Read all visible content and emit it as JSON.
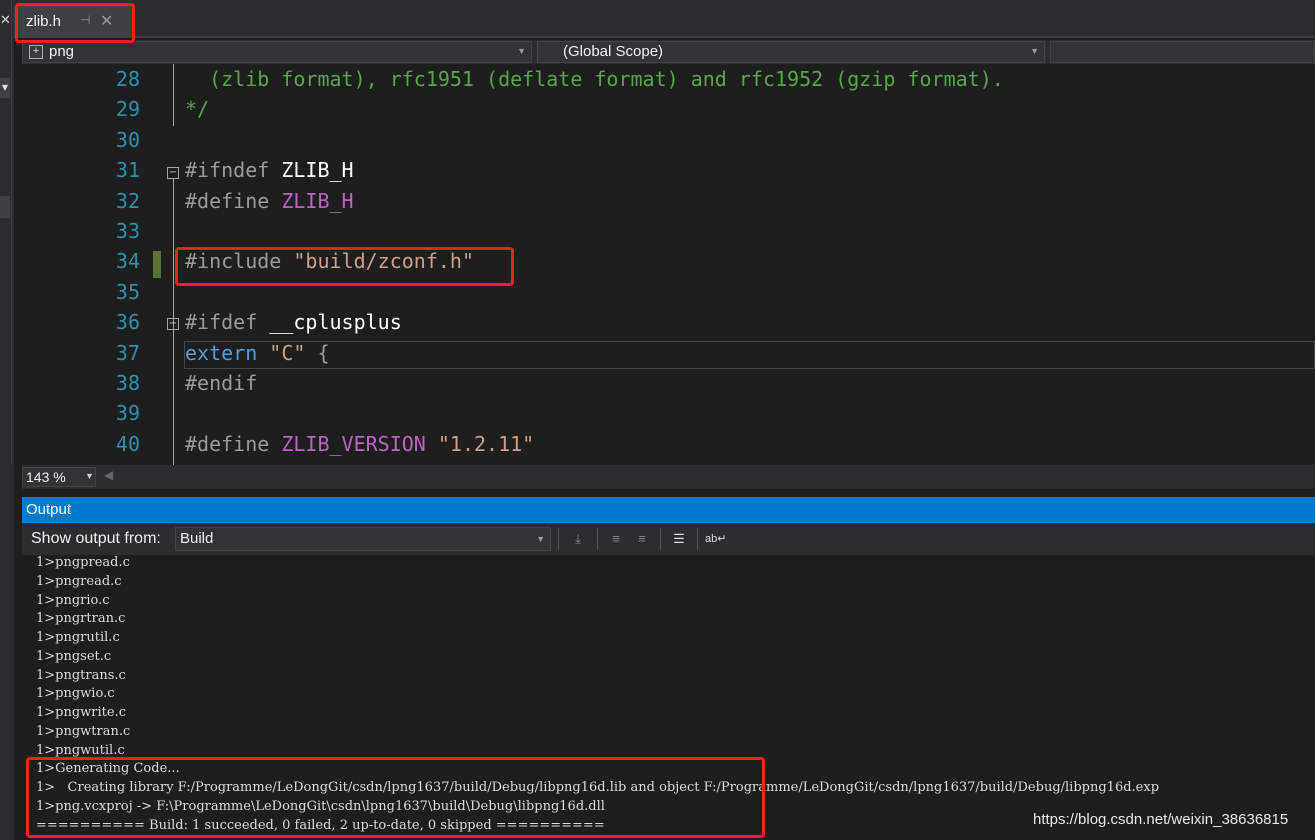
{
  "tab": {
    "title": "zlib.h",
    "pin_glyph": "⊣",
    "close_glyph": "✕"
  },
  "nav": {
    "project": "png",
    "scope": "(Global Scope)",
    "member": ""
  },
  "editor": {
    "lines": [
      {
        "num": "28",
        "segments": [
          {
            "t": "  (zlib format), rfc1951 (deflate format) and rfc1952 (gzip format).",
            "c": "cm"
          }
        ]
      },
      {
        "num": "29",
        "segments": [
          {
            "t": "*/",
            "c": "cm"
          }
        ]
      },
      {
        "num": "30",
        "segments": []
      },
      {
        "num": "31",
        "segments": [
          {
            "t": "#ifndef ",
            "c": "pp"
          },
          {
            "t": "ZLIB_H",
            "c": "id"
          }
        ]
      },
      {
        "num": "32",
        "segments": [
          {
            "t": "#define ",
            "c": "pp"
          },
          {
            "t": "ZLIB_H",
            "c": "mac"
          }
        ]
      },
      {
        "num": "33",
        "segments": []
      },
      {
        "num": "34",
        "segments": [
          {
            "t": "#include ",
            "c": "pp"
          },
          {
            "t": "\"build/zconf.h\"",
            "c": "str"
          }
        ]
      },
      {
        "num": "35",
        "segments": []
      },
      {
        "num": "36",
        "segments": [
          {
            "t": "#ifdef ",
            "c": "pp"
          },
          {
            "t": "__cplusplus",
            "c": "id"
          }
        ]
      },
      {
        "num": "37",
        "segments": [
          {
            "t": "extern ",
            "c": "kw"
          },
          {
            "t": "\"C\" ",
            "c": "str"
          },
          {
            "t": "{",
            "c": "pp"
          }
        ]
      },
      {
        "num": "38",
        "segments": [
          {
            "t": "#endif",
            "c": "pp"
          }
        ]
      },
      {
        "num": "39",
        "segments": []
      },
      {
        "num": "40",
        "segments": [
          {
            "t": "#define ",
            "c": "pp"
          },
          {
            "t": "ZLIB_VERSION ",
            "c": "mac"
          },
          {
            "t": "\"1.2.11\"",
            "c": "str"
          }
        ]
      }
    ],
    "zoom": "143 %"
  },
  "output": {
    "title": "Output",
    "show_label": "Show output from:",
    "source": "Build",
    "lines": [
      "1>pngpread.c",
      "1>pngread.c",
      "1>pngrio.c",
      "1>pngrtran.c",
      "1>pngrutil.c",
      "1>pngset.c",
      "1>pngtrans.c",
      "1>pngwio.c",
      "1>pngwrite.c",
      "1>pngwtran.c",
      "1>pngwutil.c",
      "1>Generating Code...",
      "1>   Creating library F:/Programme/LeDongGit/csdn/lpng1637/build/Debug/libpng16d.lib and object F:/Programme/LeDongGit/csdn/lpng1637/build/Debug/libpng16d.exp",
      "1>png.vcxproj -> F:\\Programme\\LeDongGit\\csdn\\lpng1637\\build\\Debug\\libpng16d.dll",
      "========== Build: 1 succeeded, 0 failed, 2 up-to-date, 0 skipped =========="
    ]
  },
  "watermark": "https://blog.csdn.net/weixin_38636815",
  "colors": {
    "accent": "#007acc",
    "highlight": "#ff1d1d",
    "comment": "#57a64a",
    "keyword": "#569cd6",
    "string": "#d69d85",
    "macro": "#bd63c5",
    "line_number": "#2b91af"
  }
}
